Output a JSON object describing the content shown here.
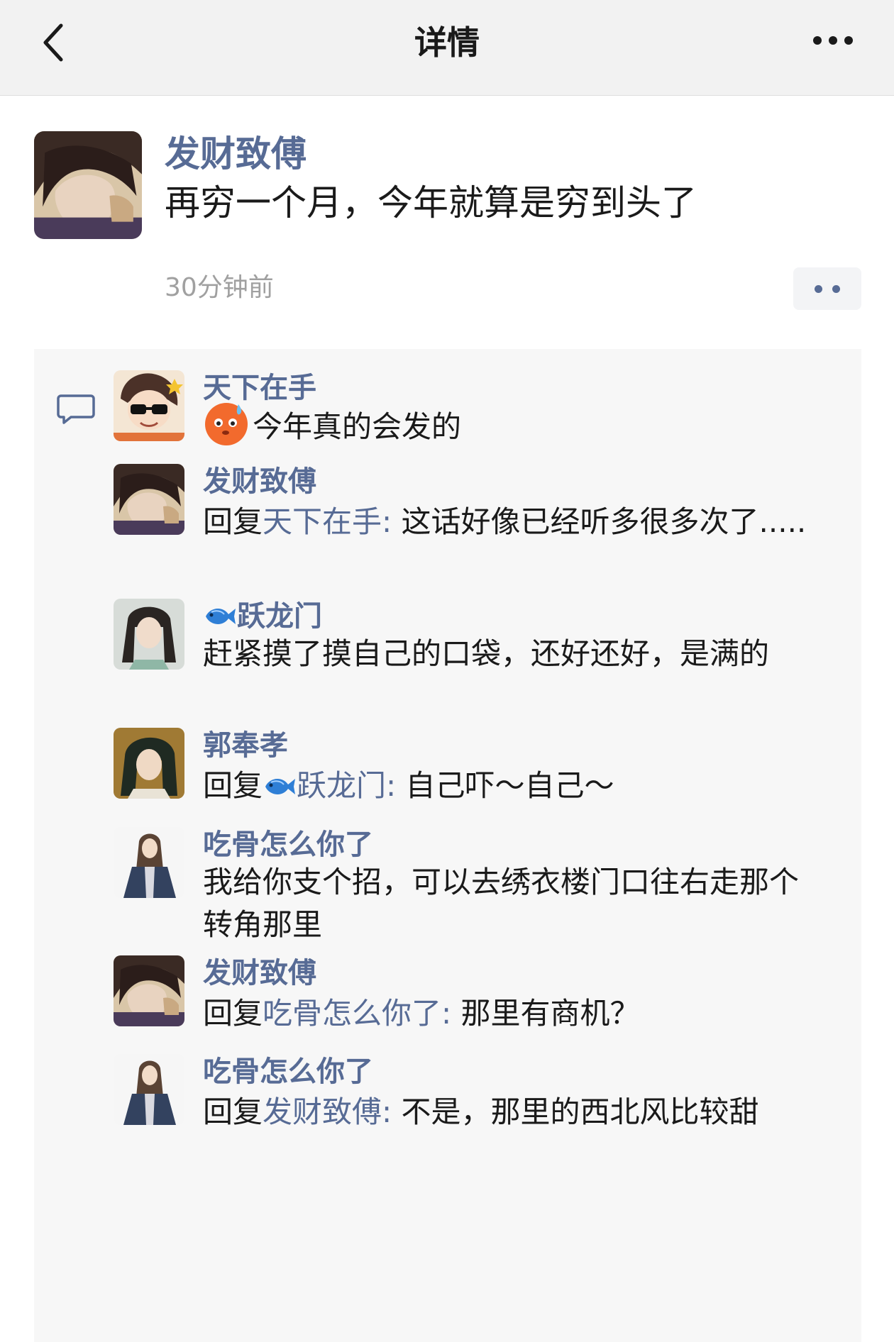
{
  "nav": {
    "title": "详情",
    "back_icon": "chevron-left-icon",
    "more_icon": "more-horizontal-icon"
  },
  "post": {
    "author": "发财致傅",
    "text": "再穷一个月，今年就算是穷到头了",
    "time": "30分钟前"
  },
  "comments": [
    {
      "author": "天下在手",
      "emoji": "blushing-face-emoji",
      "text": "今年真的会发的"
    },
    {
      "author": "发财致傅",
      "reply_prefix": "回复",
      "reply_to": "天下在手:",
      "text": " 这话好像已经听多很多次了....."
    },
    {
      "author": "跃龙门",
      "name_icon": "fish-icon",
      "text": "赶紧摸了摸自己的口袋，还好还好，是满的"
    },
    {
      "author": "郭奉孝",
      "reply_prefix": "回复",
      "reply_to": "跃龙门:",
      "reply_icon": "fish-icon",
      "text": " 自己吓～自己～"
    },
    {
      "author": "吃骨怎么你了",
      "text": "我给你支个招，可以去绣衣楼门口往右走那个转角那里"
    },
    {
      "author": "发财致傅",
      "reply_prefix": "回复",
      "reply_to": "吃骨怎么你了:",
      "text": " 那里有商机？"
    },
    {
      "author": "吃骨怎么你了",
      "reply_prefix": "回复",
      "reply_to": "发财致傅:",
      "text": " 不是，那里的西北风比较甜"
    }
  ],
  "colors": {
    "link": "#576b95",
    "nav_bg": "#f2f2f2",
    "comment_bg": "#f7f7f7"
  }
}
